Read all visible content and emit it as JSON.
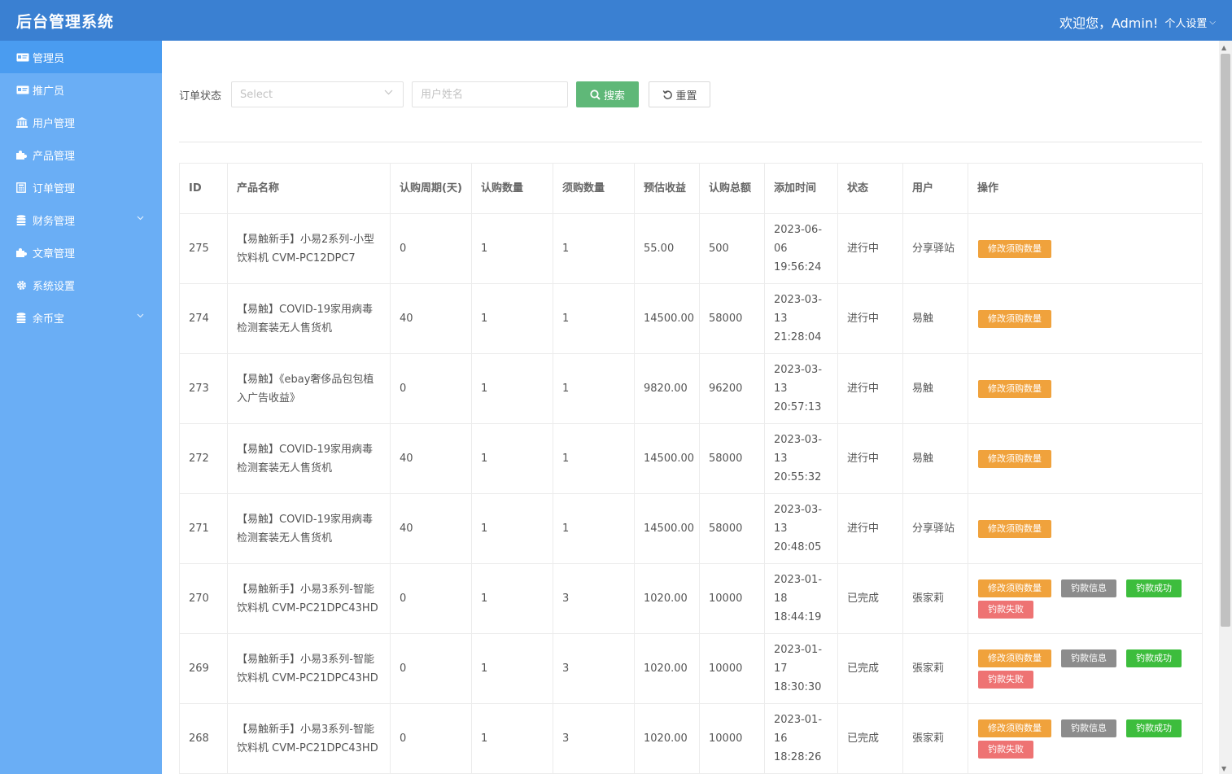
{
  "header": {
    "title": "后台管理系统",
    "welcome": "欢迎您，Admin!",
    "settings_label": "个人设置"
  },
  "sidebar": {
    "items": [
      {
        "label": "管理员",
        "icon": "id-card-icon",
        "active": true
      },
      {
        "label": "推广员",
        "icon": "id-card-icon"
      },
      {
        "label": "用户管理",
        "icon": "bank-icon"
      },
      {
        "label": "产品管理",
        "icon": "puzzle-icon"
      },
      {
        "label": "订单管理",
        "icon": "calculator-icon"
      },
      {
        "label": "财务管理",
        "icon": "database-icon",
        "expandable": true
      },
      {
        "label": "文章管理",
        "icon": "puzzle-icon"
      },
      {
        "label": "系统设置",
        "icon": "gear-icon"
      },
      {
        "label": "余币宝",
        "icon": "database-icon",
        "expandable": true
      }
    ]
  },
  "filter": {
    "status_label": "订单状态",
    "select_placeholder": "Select",
    "username_placeholder": "用户姓名",
    "search_label": "搜索",
    "reset_label": "重置"
  },
  "table": {
    "headers": [
      "ID",
      "产品名称",
      "认购周期(天)",
      "认购数量",
      "须购数量",
      "预估收益",
      "认购总额",
      "添加时间",
      "状态",
      "用户",
      "操作"
    ],
    "rows": [
      {
        "id": "275",
        "name": "【易触新手】小易2系列-小型饮料机 CVM-PC12DPC7",
        "period": "0",
        "qty": "1",
        "need": "1",
        "income": "55.00",
        "total": "500",
        "time": "2023-06-06 19:56:24",
        "status": "进行中",
        "user": "分享驿站",
        "ops": [
          "修改须购数量"
        ]
      },
      {
        "id": "274",
        "name": "【易触】COVID-19家用病毒检测套装无人售货机",
        "period": "40",
        "qty": "1",
        "need": "1",
        "income": "14500.00",
        "total": "58000",
        "time": "2023-03-13 21:28:04",
        "status": "进行中",
        "user": "易触",
        "ops": [
          "修改须购数量"
        ]
      },
      {
        "id": "273",
        "name": "【易触】《ebay奢侈品包包植入广告收益》",
        "period": "0",
        "qty": "1",
        "need": "1",
        "income": "9820.00",
        "total": "96200",
        "time": "2023-03-13 20:57:13",
        "status": "进行中",
        "user": "易触",
        "ops": [
          "修改须购数量"
        ]
      },
      {
        "id": "272",
        "name": "【易触】COVID-19家用病毒检测套装无人售货机",
        "period": "40",
        "qty": "1",
        "need": "1",
        "income": "14500.00",
        "total": "58000",
        "time": "2023-03-13 20:55:32",
        "status": "进行中",
        "user": "易触",
        "ops": [
          "修改须购数量"
        ]
      },
      {
        "id": "271",
        "name": "【易触】COVID-19家用病毒检测套装无人售货机",
        "period": "40",
        "qty": "1",
        "need": "1",
        "income": "14500.00",
        "total": "58000",
        "time": "2023-03-13 20:48:05",
        "status": "进行中",
        "user": "分享驿站",
        "ops": [
          "修改须购数量"
        ]
      },
      {
        "id": "270",
        "name": "【易触新手】小易3系列-智能饮料机 CVM-PC21DPC43HD",
        "period": "0",
        "qty": "1",
        "need": "3",
        "income": "1020.00",
        "total": "10000",
        "time": "2023-01-18 18:44:19",
        "status": "已完成",
        "user": "張家莉",
        "ops": [
          "修改须购数量",
          "钓款信息",
          "钓款成功",
          "钓款失败"
        ]
      },
      {
        "id": "269",
        "name": "【易触新手】小易3系列-智能饮料机 CVM-PC21DPC43HD",
        "period": "0",
        "qty": "1",
        "need": "3",
        "income": "1020.00",
        "total": "10000",
        "time": "2023-01-17 18:30:30",
        "status": "已完成",
        "user": "張家莉",
        "ops": [
          "修改须购数量",
          "钓款信息",
          "钓款成功",
          "钓款失败"
        ]
      },
      {
        "id": "268",
        "name": "【易触新手】小易3系列-智能饮料机 CVM-PC21DPC43HD",
        "period": "0",
        "qty": "1",
        "need": "3",
        "income": "1020.00",
        "total": "10000",
        "time": "2023-01-16 18:28:26",
        "status": "已完成",
        "user": "張家莉",
        "ops": [
          "修改须购数量",
          "钓款信息",
          "钓款成功",
          "钓款失败"
        ]
      }
    ]
  },
  "colors": {
    "header_bg": "#3a80d2",
    "sidebar_bg": "#6aaef5",
    "sidebar_active": "#4a9cf0",
    "btn_search": "#5fb878",
    "op_orange": "#f0a23c",
    "op_gray": "#8c8c8c",
    "op_green": "#3dbd3d",
    "op_red": "#ee7373"
  }
}
